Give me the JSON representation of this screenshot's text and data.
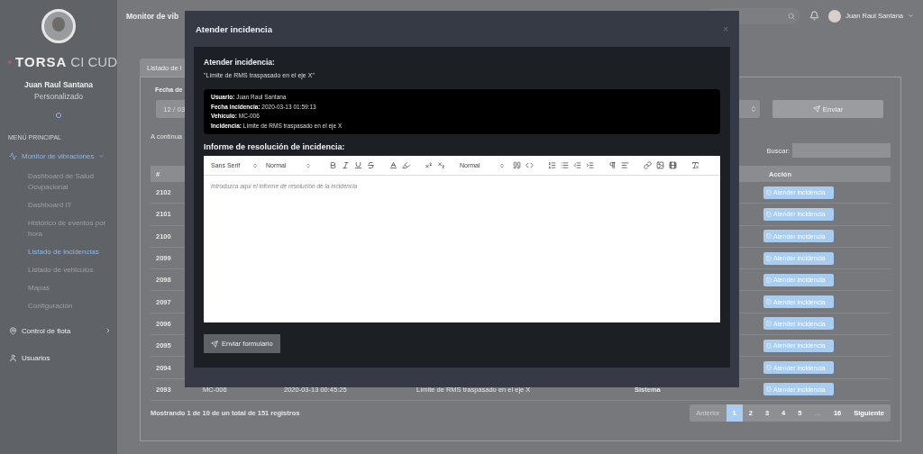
{
  "sidebar": {
    "brand": {
      "name": "TORSA",
      "suffix": "CI CUD"
    },
    "user": {
      "name": "Juan Raul Santana",
      "role": "Personalizado"
    },
    "section_title": "MENÚ PRINCIPAL",
    "items": [
      {
        "kind": "group",
        "label": "Monitor de vibraciones",
        "expanded": true,
        "children": [
          {
            "label": "Dashboard de Salud Ocupacional",
            "selected": false
          },
          {
            "label": "Dashboard IT",
            "selected": false
          },
          {
            "label": "Histórico de eventos por hora",
            "selected": false
          },
          {
            "label": "Listado de incidencias",
            "selected": true
          },
          {
            "label": "Listado de vehiculos",
            "selected": false
          },
          {
            "label": "Mapas",
            "selected": false
          },
          {
            "label": "Configuración",
            "selected": false
          }
        ]
      },
      {
        "kind": "group",
        "label": "Control de flota",
        "expanded": false
      },
      {
        "kind": "link",
        "label": "Usuarios"
      }
    ]
  },
  "topbar": {
    "title": "Monitor de vib",
    "user": "Juan Raul Santana"
  },
  "page": {
    "tab": "Listado de i",
    "date_label": "Fecha de",
    "date_value": "12 / 03",
    "send_button": "Enviar",
    "intro": "A continua",
    "search_label": "Buscar:",
    "table": {
      "columns": [
        "#",
        "",
        "",
        "",
        "",
        "Acción"
      ],
      "rows": [
        {
          "cells": [
            "2102",
            "",
            "",
            "",
            "",
            ""
          ],
          "action": "Atender incidencia"
        },
        {
          "cells": [
            "2101",
            "",
            "",
            "",
            "",
            ""
          ],
          "action": "Atender incidencia"
        },
        {
          "cells": [
            "2100",
            "",
            "",
            "",
            "",
            ""
          ],
          "action": "Atender incidencia"
        },
        {
          "cells": [
            "2099",
            "",
            "",
            "",
            "",
            ""
          ],
          "action": "Atender incidencia"
        },
        {
          "cells": [
            "2098",
            "",
            "",
            "",
            "",
            ""
          ],
          "action": "Atender incidencia"
        },
        {
          "cells": [
            "2097",
            "",
            "",
            "",
            "",
            ""
          ],
          "action": "Atender incidencia"
        },
        {
          "cells": [
            "2096",
            "",
            "",
            "",
            "",
            ""
          ],
          "action": "Atender incidencia"
        },
        {
          "cells": [
            "2095",
            "",
            "",
            "",
            "",
            ""
          ],
          "action": "Atender incidencia"
        },
        {
          "cells": [
            "2094",
            "",
            "",
            "",
            "",
            ""
          ],
          "action": "Atender incidencia"
        },
        {
          "cells": [
            "2093",
            "MC-006",
            "2020-03-13 00:45:25",
            "Límite de RMS traspasado en el eje X",
            "Sistema",
            ""
          ],
          "action": "Atender incidencia"
        }
      ]
    },
    "footer": "Mostrando 1 de 10 de un total de 151 registros",
    "pagination": [
      {
        "label": "Anterior",
        "selected": false,
        "disabled": true
      },
      {
        "label": "1",
        "selected": true,
        "disabled": false
      },
      {
        "label": "2",
        "selected": false,
        "disabled": false
      },
      {
        "label": "3",
        "selected": false,
        "disabled": false
      },
      {
        "label": "4",
        "selected": false,
        "disabled": false
      },
      {
        "label": "5",
        "selected": false,
        "disabled": false
      },
      {
        "label": "…",
        "selected": false,
        "disabled": true
      },
      {
        "label": "16",
        "selected": false,
        "disabled": false
      },
      {
        "label": "Siguiente",
        "selected": false,
        "disabled": false
      }
    ]
  },
  "modal": {
    "title": "Atender incidencia",
    "close": "×",
    "heading": "Atender incidencia:",
    "quote": "\"Límite de RMS traspasado en el eje X\"",
    "details": [
      "**Usuario:** Juan Raul Santana",
      "**Fecha incidencia:** 2020-03-13 01:59:13",
      "**Vehículo:** MC-006",
      "**Incidencia:** Límite de RMS traspasado en el eje X"
    ],
    "report_heading": "Informe de resolución de incidencia:",
    "editor": {
      "selects": [
        "Sans Serif",
        "Normal",
        "Normal"
      ],
      "placeholder": "Introduzca aquí el informe de resolución de la incidencia"
    },
    "submit": "Enviar formulario"
  }
}
